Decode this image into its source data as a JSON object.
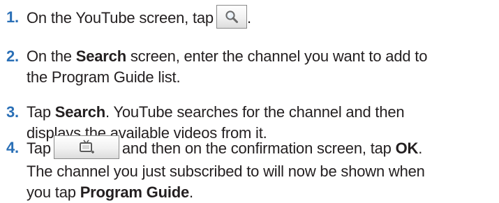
{
  "steps": [
    {
      "number": "1.",
      "before_icon": "On the YouTube screen, tap",
      "icon": "search-icon",
      "after_icon": "."
    },
    {
      "number": "2.",
      "prefix": "On the ",
      "bold": "Search",
      "suffix": " screen, enter the channel you want to add to",
      "line2": "the Program Guide list."
    },
    {
      "number": "3.",
      "prefix": "Tap ",
      "bold": "Search",
      "suffix": ". YouTube searches for the channel and then",
      "line2": "displays the available videos from it."
    },
    {
      "number": "4.",
      "before_icon": "Tap",
      "icon": "subscribe-tv-icon",
      "after_icon": "and then on the confirmation screen, tap ",
      "bold_ok": "OK",
      "end1": ".",
      "line2": "The channel you just subscribed to will now be shown when",
      "line3_prefix": "you tap ",
      "line3_bold": "Program Guide",
      "line3_end": "."
    }
  ],
  "colors": {
    "step_number": "#2a6fb6",
    "text": "#231f20"
  }
}
